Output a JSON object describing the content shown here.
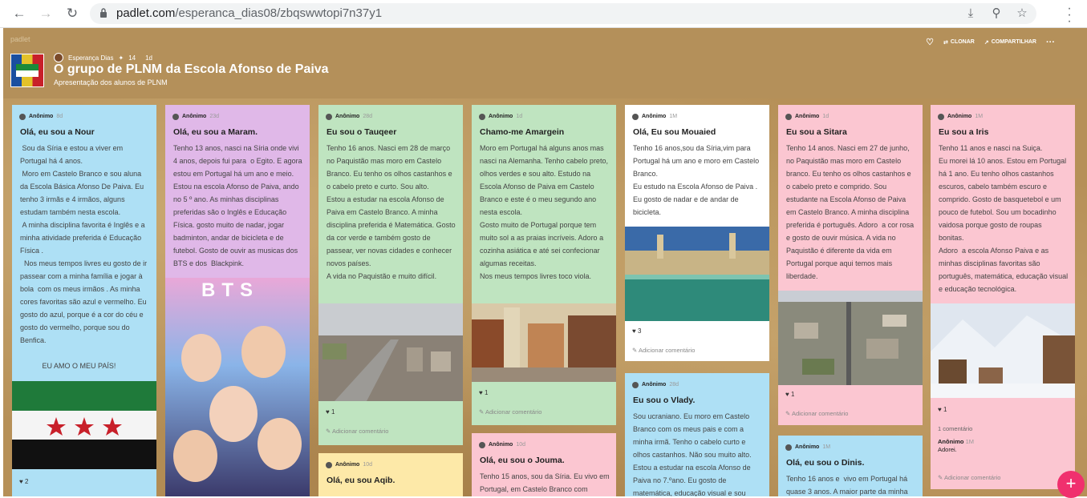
{
  "browser": {
    "url_host": "padlet.com",
    "url_path": "/esperanca_dias08/zbqswwtopi7n37y1",
    "icons": [
      "back-icon",
      "forward-icon",
      "reload-icon",
      "lock-icon",
      "install-icon",
      "zoom-icon",
      "star-icon",
      "menu-icon"
    ]
  },
  "header": {
    "brand": "padlet",
    "author": "Esperança Dias",
    "likes": "14",
    "age": "1d",
    "title": "O grupo de PLNM da Escola Afonso de Paiva",
    "subtitle": "Apresentação dos alunos de PLNM",
    "actions": {
      "clone": "CLONAR",
      "share": "COMPARTILHAR"
    }
  },
  "colors": {
    "blue": "#aee0f5",
    "purple": "#e0b8e8",
    "green": "#bfe4c0",
    "pink": "#fbc6d1",
    "white": "#ffffff",
    "yellow": "#fde9a8",
    "fab": "#f0306e"
  },
  "cards": [
    {
      "author": "Anônimo",
      "age": "8d",
      "title": "Olá, eu sou a Nour",
      "body": " Sou da Síria e estou a viver em Portugal há 4 anos.\n Moro em Castelo Branco e sou aluna da Escola Básica Afonso De Paiva. Eu tenho 3 irmãs e 4 irmãos, alguns estudam também nesta escola.\n A minha disciplina favorita é Inglês e a minha atividade preferida é Educação Física .\n  Nos meus tempos livres eu gosto de ir passear com a minha família e jogar à bola  com os meus irmãos . As minha cores favoritas são azul e vermelho. Eu gosto do azul, porque é a cor do céu e gosto do vermelho, porque sou do Benfica.\n\n           EU AMO O MEU PAÍS!",
      "likes": "2"
    },
    {
      "author": "Anônimo",
      "age": "23d",
      "title": "Olá, eu sou a Maram.",
      "body": "Tenho 13 anos, nasci na Síria onde vivi  4 anos, depois fui para  o Egito. E agora estou em Portugal há um ano e meio. Estou na escola Afonso de Paiva, ando no 5 º ano. As minhas disciplinas preferidas são o Inglês e Educação Física. gosto muito de nadar, jogar badminton, andar de bicicleta e de futebol. Gosto de ouvir as musicas dos  BTS e dos  Blackpink.",
      "img_text": "BTS"
    },
    {
      "author": "Anônimo",
      "age": "28d",
      "title": "Eu sou o Tauqeer",
      "body": "Tenho 16 anos. Nasci em 28 de março no Paquistão mas moro em Castelo Branco. Eu tenho os olhos castanhos e o cabelo preto e curto. Sou alto.\nEstou a estudar na escola Afonso de Paiva em Castelo Branco. A minha disciplina preferida é Matemática. Gosto da cor verde e também gosto de passear, ver novas cidades e conhecer novos países.\nA vida no Paquistão e muito difícil.",
      "likes": "1",
      "add": "Adicionar comentário"
    },
    {
      "author": "Anônimo",
      "age": "10d",
      "title": "Olá, eu sou Aqib."
    },
    {
      "author": "Anônimo",
      "age": "1d",
      "title": "Chamo-me Amargein",
      "body": "Moro em Portugal há alguns anos mas nasci na Alemanha. Tenho cabelo preto, olhos verdes e sou alto. Estudo na Escola Afonso de Paiva em Castelo Branco e este é o meu segundo ano nesta escola.\nGosto muito de Portugal porque tem muito sol a as praias incríveis. Adoro a cozinha asiática e até sei confecionar algumas receitas.\nNos meus tempos livres toco viola.",
      "likes": "1",
      "add": "Adicionar comentário"
    },
    {
      "author": "Anônimo",
      "age": "10d",
      "title": "Olá, eu sou o Jouma.",
      "body": "Tenho 15 anos, sou da Síria. Eu vivo em Portugal, em Castelo Branco com"
    },
    {
      "author": "Anônimo",
      "age": "1M",
      "title": "Olá, Eu sou Mouaied",
      "body": "Tenho 16 anos,sou da Síria,vim para Portugal há um ano e moro em Castelo Branco.\nEu estudo na Escola Afonso de Paiva . Eu gosto de nadar e de andar de bicicleta.",
      "likes": "3",
      "add": "Adicionar comentário"
    },
    {
      "author": "Anônimo",
      "age": "28d",
      "title": "Eu sou o Vlady.",
      "body": "Sou ucraniano. Eu moro em Castelo Branco com os meus pais e com a minha irmã. Tenho o cabelo curto e olhos castanhos. Não sou muito alto. Estou a estudar na escola Afonso de Paiva no 7.ºano. Eu gosto de matemática, educação visual e sou"
    },
    {
      "author": "Anônimo",
      "age": "1d",
      "title": "Eu sou a Sitara",
      "body": "Tenho 14 anos. Nasci em 27 de junho, no Paquistão mas moro em Castelo branco. Eu tenho os olhos castanhos e o cabelo preto e comprido. Sou estudante na Escola Afonso de Paiva em Castelo Branco. A minha disciplina preferida é português. Adoro  a cor rosa e gosto de ouvir música. A vida no Paquistão é diferente da vida em Portugal porque aqui temos mais liberdade.",
      "likes": "1",
      "add": "Adicionar comentário"
    },
    {
      "author": "Anônimo",
      "age": "1M",
      "title": "Olá, eu sou o Dinis.",
      "body": "Tenho 16 anos e  vivo em Portugal há quase 3 anos. A maior parte da minha"
    },
    {
      "author": "Anônimo",
      "age": "1M",
      "title": "Eu sou a Iris",
      "body": "Tenho 11 anos e nasci na Suiça.\nEu morei lá 10 anos. Estou em Portugal há 1 ano. Eu tenho olhos castanhos escuros, cabelo também escuro e comprido. Gosto de basquetebol e um pouco de futebol. Sou um bocadinho vaidosa porque gosto de roupas bonitas.\nAdoro  a escola Afonso Paiva e as minhas disciplinas favoritas são português, matemática, educação visual e educação tecnológica.",
      "likes": "1",
      "comments": "1 comentário",
      "comment_author": "Anônimo",
      "comment_age": "1M",
      "comment_text": "Adorei.",
      "add": "Adicionar comentário"
    }
  ]
}
